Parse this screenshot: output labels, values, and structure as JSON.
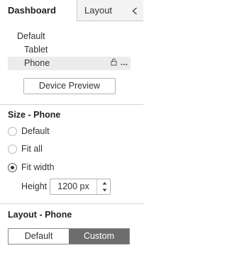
{
  "tabs": {
    "dashboard": "Dashboard",
    "layout": "Layout"
  },
  "icons": {
    "collapse": "chevron-left-icon",
    "lock": "lock-icon",
    "more": "more-icon",
    "step_up": "caret-up-icon",
    "step_down": "caret-down-icon"
  },
  "device_tree": {
    "default": "Default",
    "tablet": "Tablet",
    "phone": "Phone"
  },
  "device_preview_button": "Device Preview",
  "size_section": {
    "title": "Size - Phone",
    "options": {
      "default": "Default",
      "fit_all": "Fit all",
      "fit_width": "Fit width"
    },
    "selected": "fit_width",
    "height_label": "Height",
    "height_value": "1200 px"
  },
  "layout_section": {
    "title": "Layout - Phone",
    "default_label": "Default",
    "custom_label": "Custom",
    "selected": "custom"
  },
  "colors": {
    "selected_segment": "#6d6d6d",
    "selected_row": "#ececec",
    "inactive_tab": "#f3f3f3"
  }
}
